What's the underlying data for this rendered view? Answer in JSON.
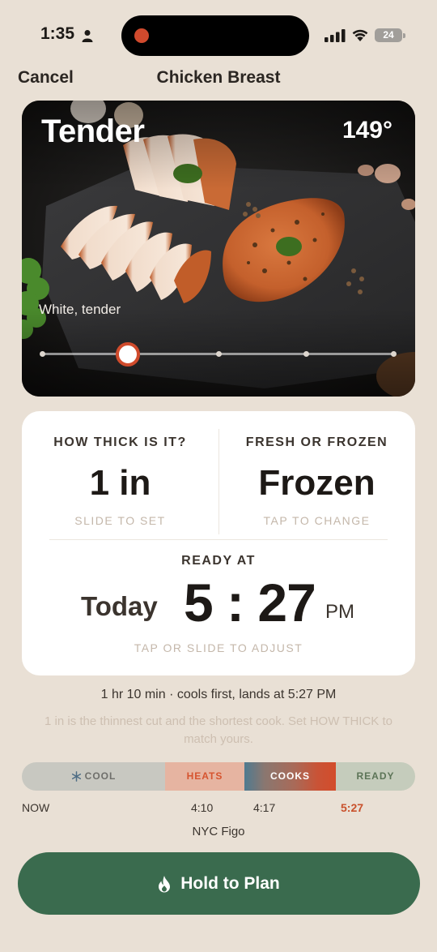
{
  "status_bar": {
    "time": "1:35",
    "battery": "24"
  },
  "nav": {
    "cancel_label": "Cancel",
    "title": "Chicken Breast"
  },
  "hero": {
    "doneness": "Tender",
    "temperature": "149°",
    "description": "White, tender",
    "slider": {
      "selected_index": 1,
      "stops": 5
    }
  },
  "settings": {
    "thickness": {
      "label": "HOW THICK IS IT?",
      "value": "1 in",
      "hint": "SLIDE TO SET"
    },
    "state": {
      "label": "FRESH OR FROZEN",
      "value": "Frozen",
      "hint": "TAP TO CHANGE"
    },
    "ready": {
      "label": "READY AT",
      "day": "Today",
      "time": "5 : 27",
      "ampm": "PM",
      "hint": "TAP OR SLIDE TO ADJUST"
    }
  },
  "summary": "1 hr 10 min · cools first, lands at 5:27 PM",
  "tip": "1 in is the thinnest cut and the shortest cook. Set HOW THICK to match yours.",
  "timeline": {
    "segments": [
      {
        "label": "COOL",
        "icon": "snowflake-icon"
      },
      {
        "label": "HEATS"
      },
      {
        "label": "COOKS"
      },
      {
        "label": "READY"
      }
    ],
    "ticks": [
      "NOW",
      "4:10",
      "4:17",
      "5:27"
    ]
  },
  "location": "NYC Figo",
  "cta": {
    "label": "Hold to Plan",
    "icon": "flame-icon"
  },
  "colors": {
    "background": "#e9e0d5",
    "accent": "#d04b2c",
    "cta": "#3a6b4e"
  }
}
